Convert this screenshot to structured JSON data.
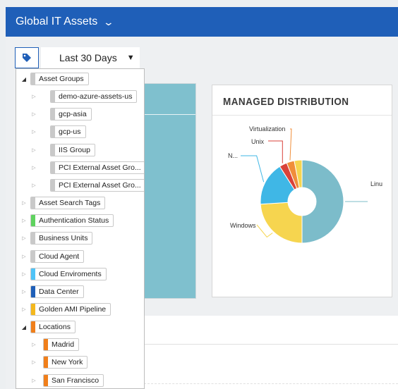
{
  "header": {
    "title": "Global IT Assets",
    "chevron_icon": "chevron-down-icon"
  },
  "toolbar": {
    "tag_icon": "tag-icon",
    "date_range": "Last 30 Days",
    "caret": "▼"
  },
  "widget": {
    "title": "MANAGED DISTRIBUTION",
    "chart_data": {
      "type": "pie",
      "title": "MANAGED DISTRIBUTION",
      "labels": [
        "Linu",
        "Windows",
        "N...",
        "Unix",
        "Virtualization",
        ""
      ],
      "values": [
        50,
        24,
        17,
        3,
        3,
        3
      ],
      "colors": [
        "#7cbcca",
        "#f6d54f",
        "#3fb7e6",
        "#d9423a",
        "#f08e3a",
        "#f6d54f"
      ]
    }
  },
  "tree": {
    "items": [
      {
        "label": "Asset Groups",
        "level": 0,
        "expanded": true,
        "color": "#c9c9c9"
      },
      {
        "label": "demo-azure-assets-us",
        "level": 1,
        "color": "#c9c9c9"
      },
      {
        "label": "gcp-asia",
        "level": 1,
        "color": "#c9c9c9"
      },
      {
        "label": "gcp-us",
        "level": 1,
        "color": "#c9c9c9"
      },
      {
        "label": "IIS Group",
        "level": 1,
        "color": "#c9c9c9"
      },
      {
        "label": "PCI External Asset Gro...",
        "level": 1,
        "color": "#c9c9c9"
      },
      {
        "label": "PCI External Asset Gro...",
        "level": 1,
        "color": "#c9c9c9"
      },
      {
        "label": "Asset Search Tags",
        "level": 0,
        "color": "#c9c9c9"
      },
      {
        "label": "Authentication Status",
        "level": 0,
        "color": "#5fd35f"
      },
      {
        "label": "Business Units",
        "level": 0,
        "color": "#c9c9c9"
      },
      {
        "label": "Cloud Agent",
        "level": 0,
        "color": "#c9c9c9"
      },
      {
        "label": "Cloud Enviroments",
        "level": 0,
        "color": "#4fc3f7"
      },
      {
        "label": "Data Center",
        "level": 0,
        "color": "#1f5fb8"
      },
      {
        "label": "Golden AMI Pipeline",
        "level": 0,
        "color": "#f4b81e"
      },
      {
        "label": "Locations",
        "level": 0,
        "expanded": true,
        "color": "#f07f1b"
      },
      {
        "label": "Madrid",
        "level": 1,
        "color": "#f07f1b"
      },
      {
        "label": "New York",
        "level": 1,
        "color": "#f07f1b"
      },
      {
        "label": "San Francisco",
        "level": 1,
        "color": "#f07f1b"
      }
    ]
  }
}
